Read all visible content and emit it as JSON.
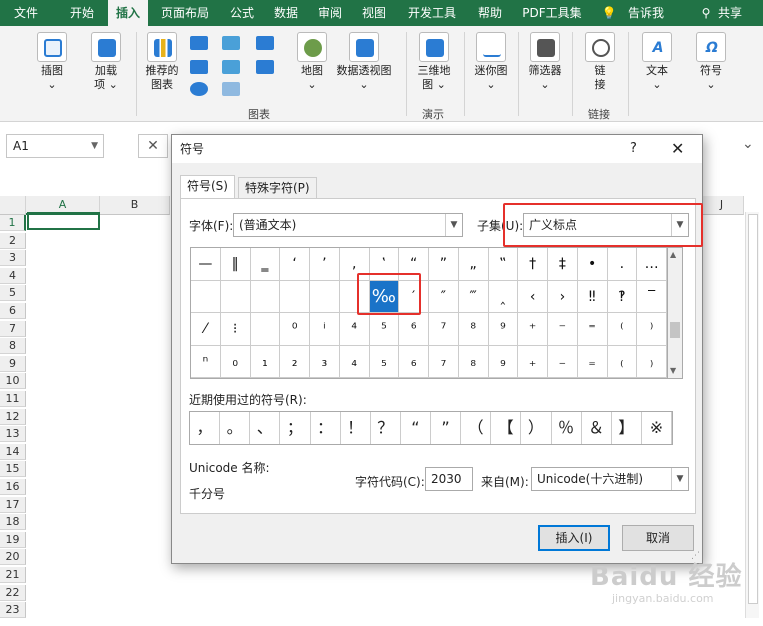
{
  "ribbon_tabs": [
    "文件",
    "开始",
    "插入",
    "页面布局",
    "公式",
    "数据",
    "审阅",
    "视图",
    "开发工具",
    "帮助",
    "PDF工具集",
    "告诉我",
    "共享"
  ],
  "ribbon": {
    "illustrations": "插图",
    "addins": "加载",
    "addins2": "项",
    "rec_charts1": "推荐的",
    "rec_charts2": "图表",
    "map": "地图",
    "pivot_chart": "数据透视图",
    "charts_group": "图表",
    "map3d_1": "三维地",
    "map3d_2": "图",
    "tours_group": "演示",
    "sparklines": "迷你图",
    "slicer": "筛选器",
    "link": "链",
    "link2": "接",
    "links_group": "链接",
    "text": "文本",
    "symbols": "符号"
  },
  "namebox": "A1",
  "columns": [
    "A",
    "B",
    "J"
  ],
  "rows": [
    "1",
    "2",
    "3",
    "4",
    "5",
    "6",
    "7",
    "8",
    "9",
    "10",
    "11",
    "12",
    "13",
    "14",
    "15",
    "16",
    "17",
    "18",
    "19",
    "20",
    "21",
    "22",
    "23"
  ],
  "dialog": {
    "title": "符号",
    "help": "?",
    "close": "✕",
    "tab_symbols": "符号(S)",
    "tab_special": "特殊字符(P)",
    "font_label": "字体(F):",
    "font_value": "(普通文本)",
    "subset_label": "子集(U):",
    "subset_value": "广义标点",
    "symbol_grid": [
      "—",
      "‖",
      "‗",
      "‘",
      "’",
      "‚",
      "‛",
      "“",
      "”",
      "„",
      "‟",
      "†",
      "‡",
      "•",
      "․",
      "…",
      "",
      "",
      "",
      "",
      "",
      "",
      "‰",
      "′",
      "″",
      "‴",
      "‸",
      "‹",
      "›",
      "‼",
      "‽",
      "‾",
      "⁄",
      "⁝",
      "",
      "⁰",
      "ⁱ",
      "⁴",
      "⁵",
      "⁶",
      "⁷",
      "⁸",
      "⁹",
      "⁺",
      "⁻",
      "⁼",
      "⁽",
      "⁾",
      "ⁿ",
      "₀",
      "₁",
      "₂",
      "₃",
      "₄",
      "₅",
      "₆",
      "₇",
      "₈",
      "₉",
      "₊",
      "₋",
      "₌",
      "₍",
      "₎"
    ],
    "recent_label": "近期使用过的符号(R):",
    "recent_symbols": [
      "，",
      "。",
      "、",
      "；",
      "：",
      "！",
      "？",
      "“",
      "”",
      "（",
      "【",
      "）",
      "％",
      "＆",
      "】",
      "※"
    ],
    "unicode_name_label": "Unicode 名称:",
    "unicode_name_value": "千分号",
    "char_code_label": "字符代码(C):",
    "char_code_value": "2030",
    "from_label": "来自(M):",
    "from_value": "Unicode(十六进制)",
    "insert_button": "插入(I)",
    "cancel_button": "取消"
  },
  "watermark": "Baidu 经验",
  "watermark_url": "jingyan.baidu.com",
  "colors": {
    "excel_green": "#217346",
    "highlight": "#1a73c8",
    "annotation_red": "#e5302b"
  }
}
